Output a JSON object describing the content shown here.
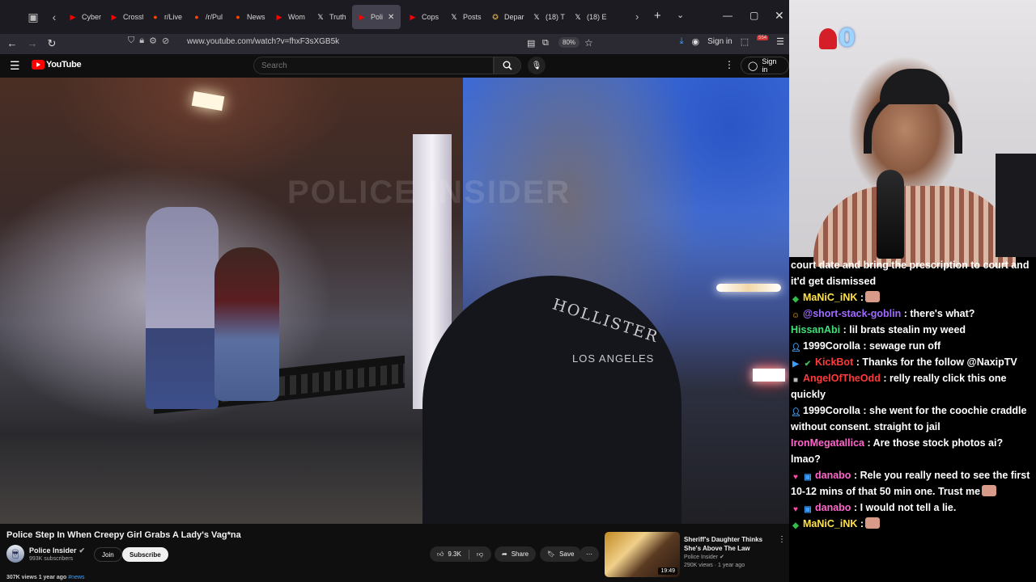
{
  "browser": {
    "tabs": [
      {
        "label": "Cyber",
        "icon": "youtube-icon",
        "color": "#ff0000"
      },
      {
        "label": "Crossf",
        "icon": "youtube-icon",
        "color": "#ff0000"
      },
      {
        "label": "r/Live",
        "icon": "reddit-icon",
        "color": "#ff4500"
      },
      {
        "label": "/r/Pul",
        "icon": "reddit-icon",
        "color": "#ff4500"
      },
      {
        "label": "News",
        "icon": "reddit-icon",
        "color": "#ff4500"
      },
      {
        "label": "Wom",
        "icon": "youtube-icon",
        "color": "#ff0000"
      },
      {
        "label": "Truth",
        "icon": "x-icon",
        "color": "#ffffff"
      },
      {
        "label": "Poli",
        "icon": "youtube-icon",
        "color": "#ff0000",
        "active": true
      },
      {
        "label": "Cops",
        "icon": "youtube-icon",
        "color": "#ff0000"
      },
      {
        "label": "Posts",
        "icon": "x-icon",
        "color": "#ffffff"
      },
      {
        "label": "Depar",
        "icon": "seal-icon",
        "color": "#c8a44a"
      },
      {
        "label": "(18) T",
        "icon": "x-icon",
        "color": "#ffffff"
      },
      {
        "label": "(18) E",
        "icon": "x-icon",
        "color": "#ffffff"
      }
    ],
    "url": "www.youtube.com/watch?v=fhxF3sXGB5k",
    "zoom": "80%",
    "signin": "Sign in",
    "extension_badge": "554"
  },
  "youtube": {
    "logo": "YouTube",
    "search_placeholder": "Search",
    "signin": "Sign in",
    "video": {
      "watermark": "POLICE INSIDER",
      "hoodie_text": "HOLLISTER",
      "hoodie_sub": "LOS ANGELES"
    },
    "title": "Police Step In When Creepy Girl Grabs A Lady's Vag*na",
    "channel": {
      "name": "Police Insider",
      "verified": "✔",
      "subscribers": "993K subscribers",
      "join": "Join",
      "subscribe": "Subscribe"
    },
    "actions": {
      "likes": "9.3K",
      "share": "Share",
      "save": "Save"
    },
    "meta": {
      "views": "307K views  1 year ago",
      "tag": "#news"
    },
    "recommended": {
      "title": "Sheriff's Daughter Thinks She's Above The Law",
      "channel": "Police Insider",
      "meta": "290K views · 1 year ago",
      "duration": "19:49"
    }
  },
  "stream": {
    "viewer_count": "0",
    "chat": [
      {
        "user": "",
        "user_color": "#ffffff",
        "badges": [],
        "text": "court date and bring the prescription to court and it'd get dismissed"
      },
      {
        "user": "MaNiC_iNK",
        "user_color": "#ffe14a",
        "badges": [
          {
            "icon": "diamond-icon",
            "color": "#2fbf4a"
          }
        ],
        "text": ":",
        "emote": true
      },
      {
        "user": "@short-stack-goblin",
        "user_color": "#a06bff",
        "badges": [
          {
            "icon": "smile-icon",
            "color": "#f2b31b"
          }
        ],
        "text": ": there's what?"
      },
      {
        "user": "HissanAbi",
        "user_color": "#3fe07a",
        "badges": [],
        "text": ": lil brats stealin my weed"
      },
      {
        "user": "1999Corolla",
        "user_color": "#ffffff",
        "badges": [
          {
            "icon": "person-icon",
            "color": "#4aa8ff"
          }
        ],
        "text": ": sewage run off"
      },
      {
        "user": "KickBot",
        "user_color": "#ff3a3a",
        "badges": [
          {
            "icon": "bot-icon",
            "color": "#3aa0ff"
          },
          {
            "icon": "check-icon",
            "color": "#3fbf5a"
          }
        ],
        "text": ": Thanks for the follow @NaxipTV"
      },
      {
        "user": "AngelOfTheOdd",
        "user_color": "#ff3a3a",
        "badges": [
          {
            "icon": "square-icon",
            "color": "#bbbbbb"
          }
        ],
        "text": ": relly really click this one quickly"
      },
      {
        "user": "1999Corolla",
        "user_color": "#ffffff",
        "badges": [
          {
            "icon": "person-icon",
            "color": "#4aa8ff"
          }
        ],
        "text": ": she went for the coochie craddle without consent. straight to jail"
      },
      {
        "user": "IronMegatallica",
        "user_color": "#ff66cc",
        "badges": [],
        "text": ": Are those stock photos ai? lmao?"
      },
      {
        "user": "danabo",
        "user_color": "#ff66cc",
        "badges": [
          {
            "icon": "heart-icon",
            "color": "#ff4aa8"
          },
          {
            "icon": "tv-icon",
            "color": "#3aa0ff"
          }
        ],
        "text": ": Rele you really need to see the first 10-12 mins of that 50 min one. Trust me",
        "emote": true
      },
      {
        "user": "danabo",
        "user_color": "#ff66cc",
        "badges": [
          {
            "icon": "heart-icon",
            "color": "#ff4aa8"
          },
          {
            "icon": "tv-icon",
            "color": "#3aa0ff"
          }
        ],
        "text": ": I would not tell a lie."
      },
      {
        "user": "MaNiC_iNK",
        "user_color": "#ffe14a",
        "badges": [
          {
            "icon": "diamond-icon",
            "color": "#2fbf4a"
          }
        ],
        "text": ":",
        "emote": true
      }
    ]
  }
}
